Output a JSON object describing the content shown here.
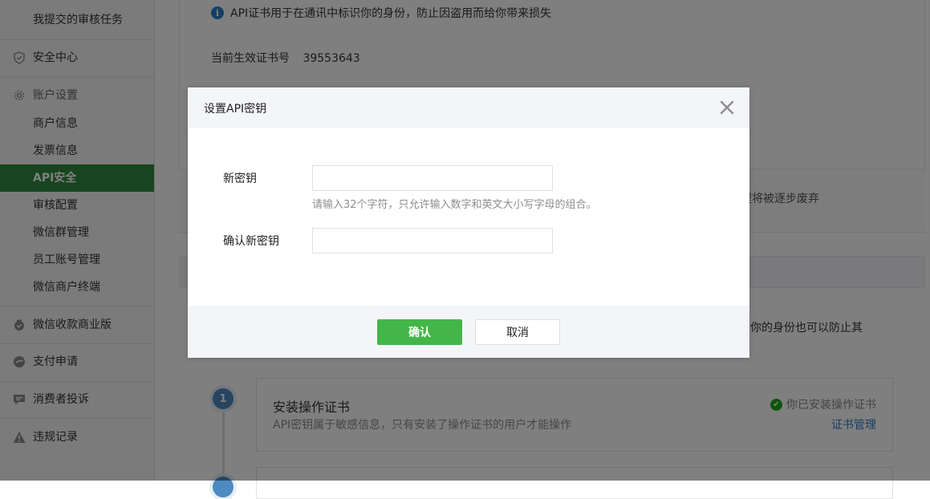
{
  "sidebar": {
    "items": [
      {
        "label": "我提交的审核任务"
      },
      {
        "label": "安全中心",
        "icon": "shield-icon"
      },
      {
        "label": "账户设置",
        "icon": "gear-icon"
      },
      {
        "label": "商户信息"
      },
      {
        "label": "发票信息"
      },
      {
        "label": "API安全",
        "active": true
      },
      {
        "label": "审核配置"
      },
      {
        "label": "微信群管理"
      },
      {
        "label": "员工账号管理"
      },
      {
        "label": "微信商户终端"
      },
      {
        "label": "微信收款商业版",
        "icon": "wallet-icon"
      },
      {
        "label": "支付申请",
        "icon": "payment-icon"
      },
      {
        "label": "消费者投诉",
        "icon": "chat-icon"
      },
      {
        "label": "违规记录",
        "icon": "warning-icon"
      }
    ],
    "active_color": "#2e8a3e"
  },
  "main": {
    "info_text": "API证书用于在通讯中标识你的身份，防止因盗用而给你带来损失",
    "cert_label": "当前生效证书号",
    "cert_number": "39553643",
    "tip_text_partial": "程将被逐步废弃",
    "desc_text_partial": "以界定你的身份也可以防止其",
    "step1": {
      "number": "1",
      "title": "安装操作证书",
      "desc": "API密钥属于敏感信息，只有安装了操作证书的用户才能操作",
      "status": "你已安装操作证书",
      "link": "证书管理"
    }
  },
  "modal": {
    "title": "设置API密钥",
    "fields": [
      {
        "label": "新密钥",
        "value": "",
        "placeholder": ""
      },
      {
        "label": "确认新密钥",
        "value": "",
        "placeholder": ""
      }
    ],
    "hint": "请输入32个字符，只允许输入数字和英文大小写字母的组合。",
    "confirm_label": "确认",
    "cancel_label": "取消",
    "confirm_color": "#44b549"
  }
}
